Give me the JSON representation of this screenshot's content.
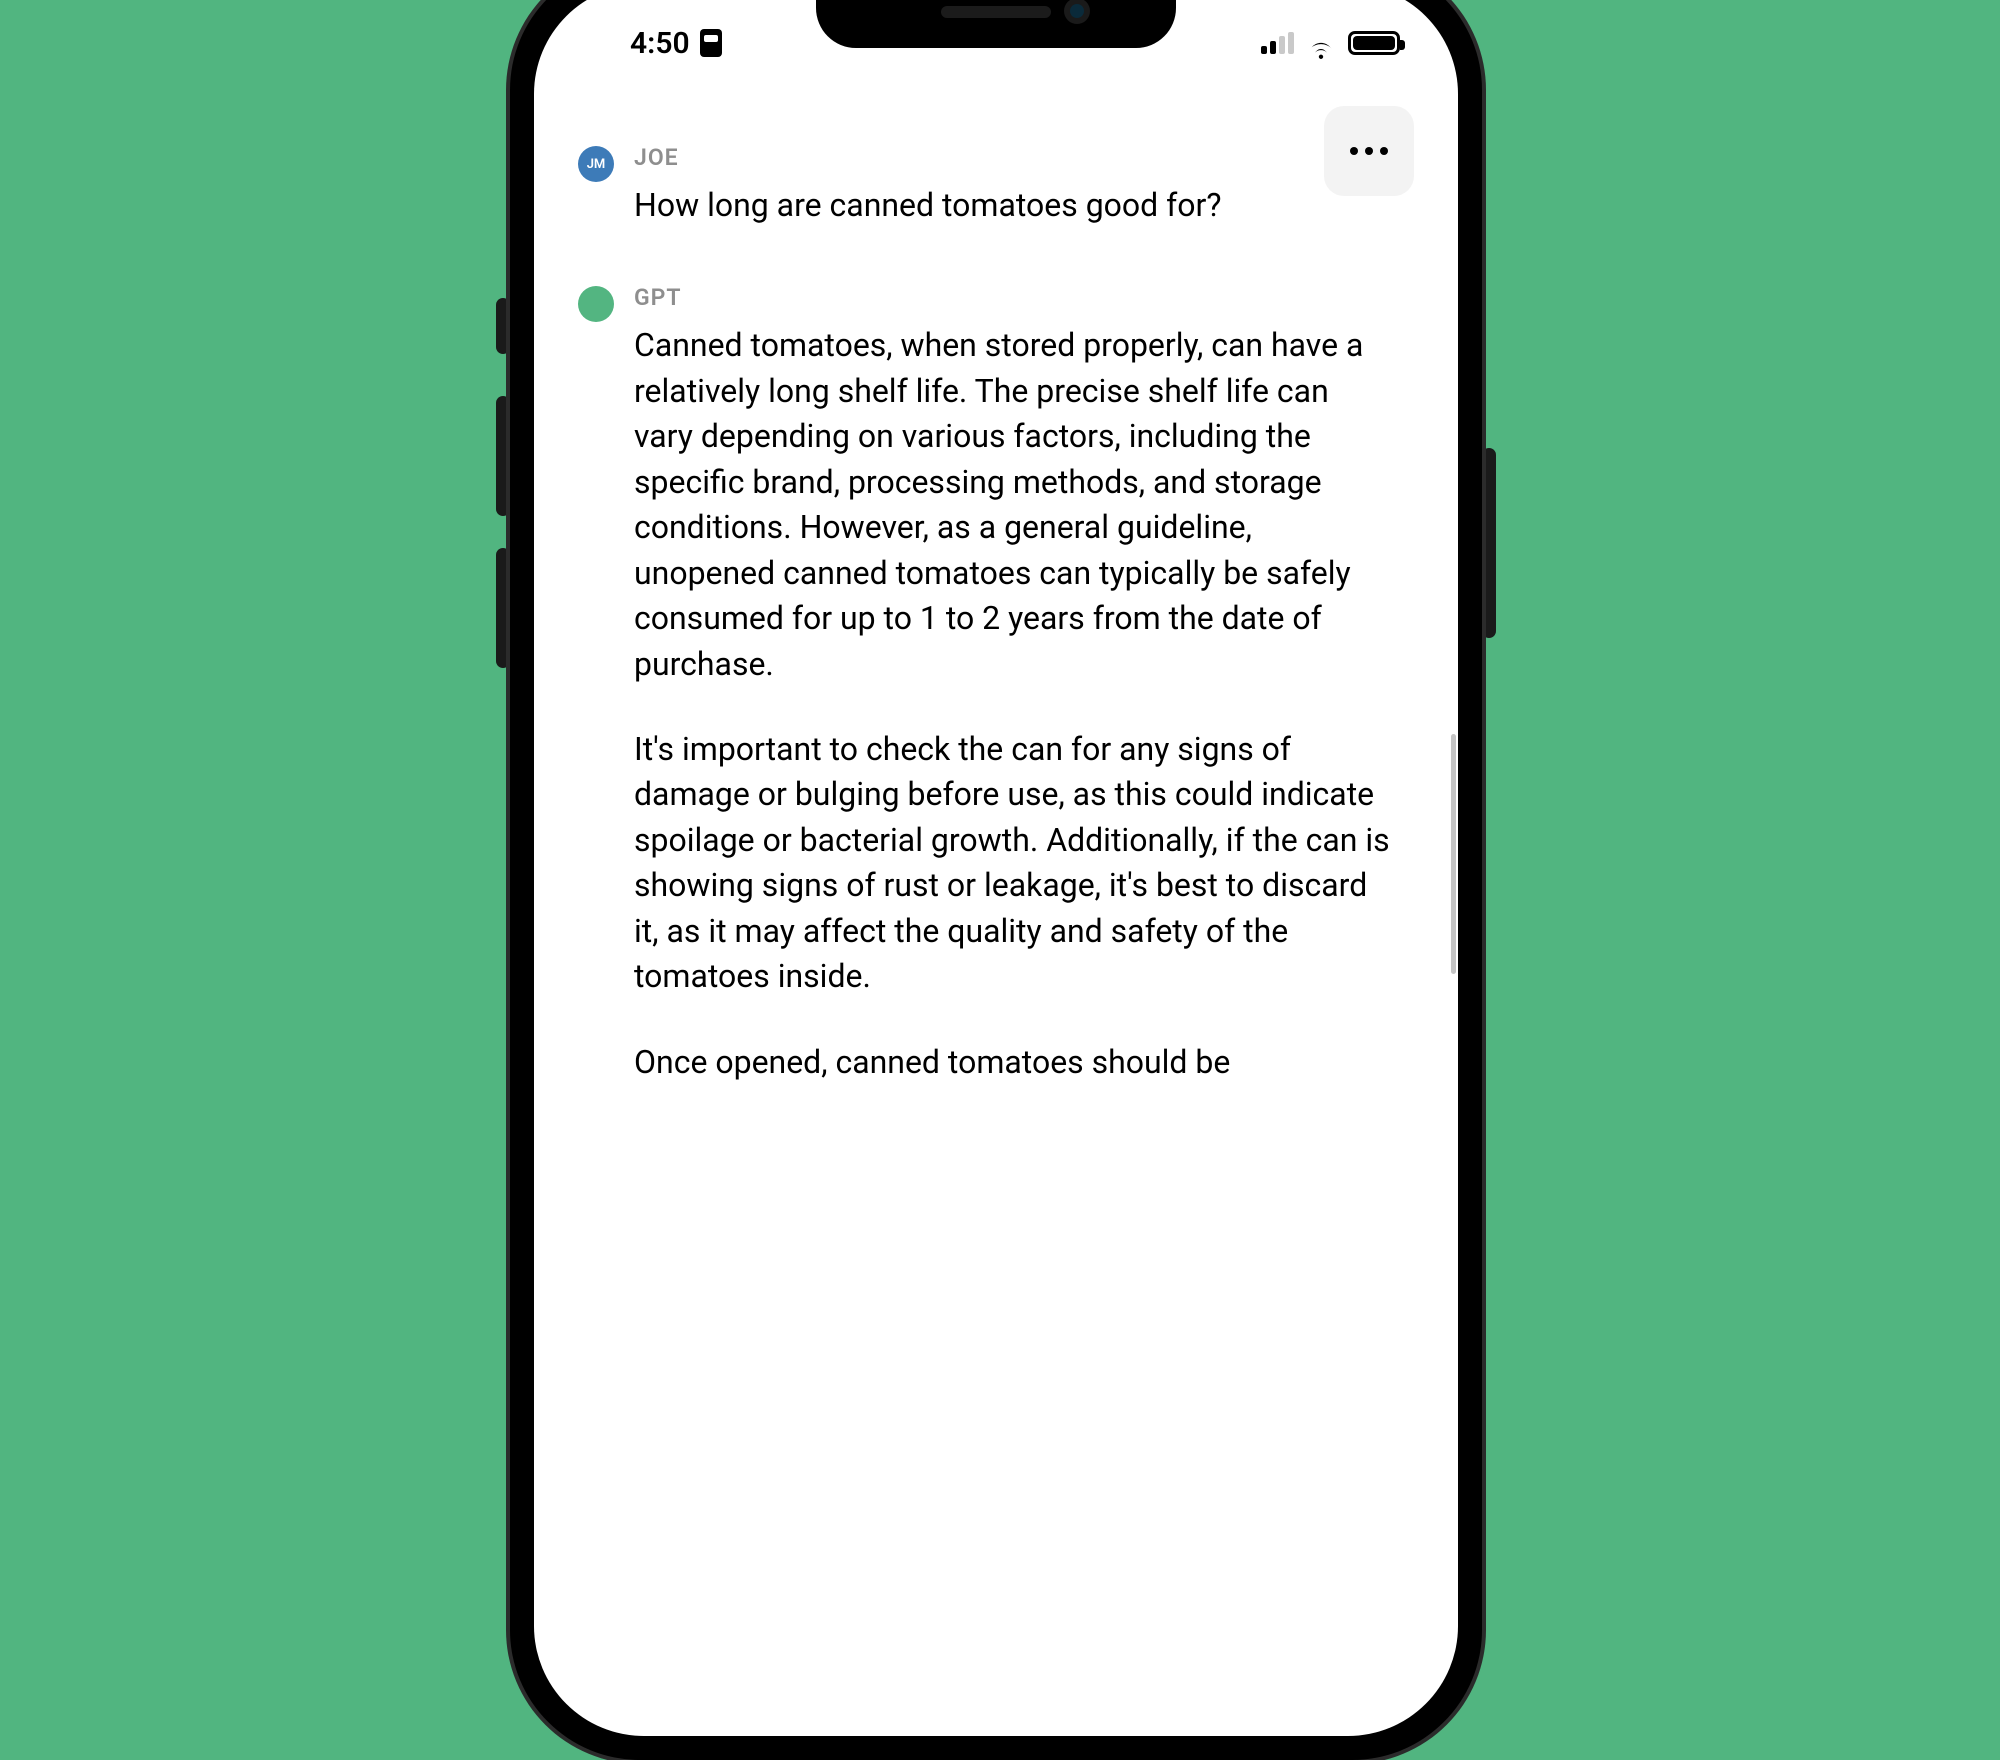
{
  "status": {
    "time": "4:50",
    "signal_bars_active": 2,
    "signal_bars_total": 4,
    "battery_percent": 100
  },
  "ui": {
    "more_button_label": "More options"
  },
  "messages": [
    {
      "role": "user",
      "name": "JOE",
      "initials": "JM",
      "avatar_color": "#3d7bb8",
      "text": "How long are canned tomatoes good for?"
    },
    {
      "role": "assistant",
      "name": "GPT",
      "initials": "",
      "avatar_color": "#53b581",
      "paragraphs": [
        "Canned tomatoes, when stored properly, can have a relatively long shelf life. The precise shelf life can vary depending on various factors, including the specific brand, processing methods, and storage conditions. However, as a general guideline, unopened canned tomatoes can typically be safely consumed for up to 1 to 2 years from the date of purchase.",
        "It's important to check the can for any signs of damage or bulging before use, as this could indicate spoilage or bacterial growth. Additionally, if the can is showing signs of rust or leakage, it's best to discard it, as it may affect the quality and safety of the tomatoes inside.",
        "Once opened, canned tomatoes should be"
      ]
    }
  ]
}
